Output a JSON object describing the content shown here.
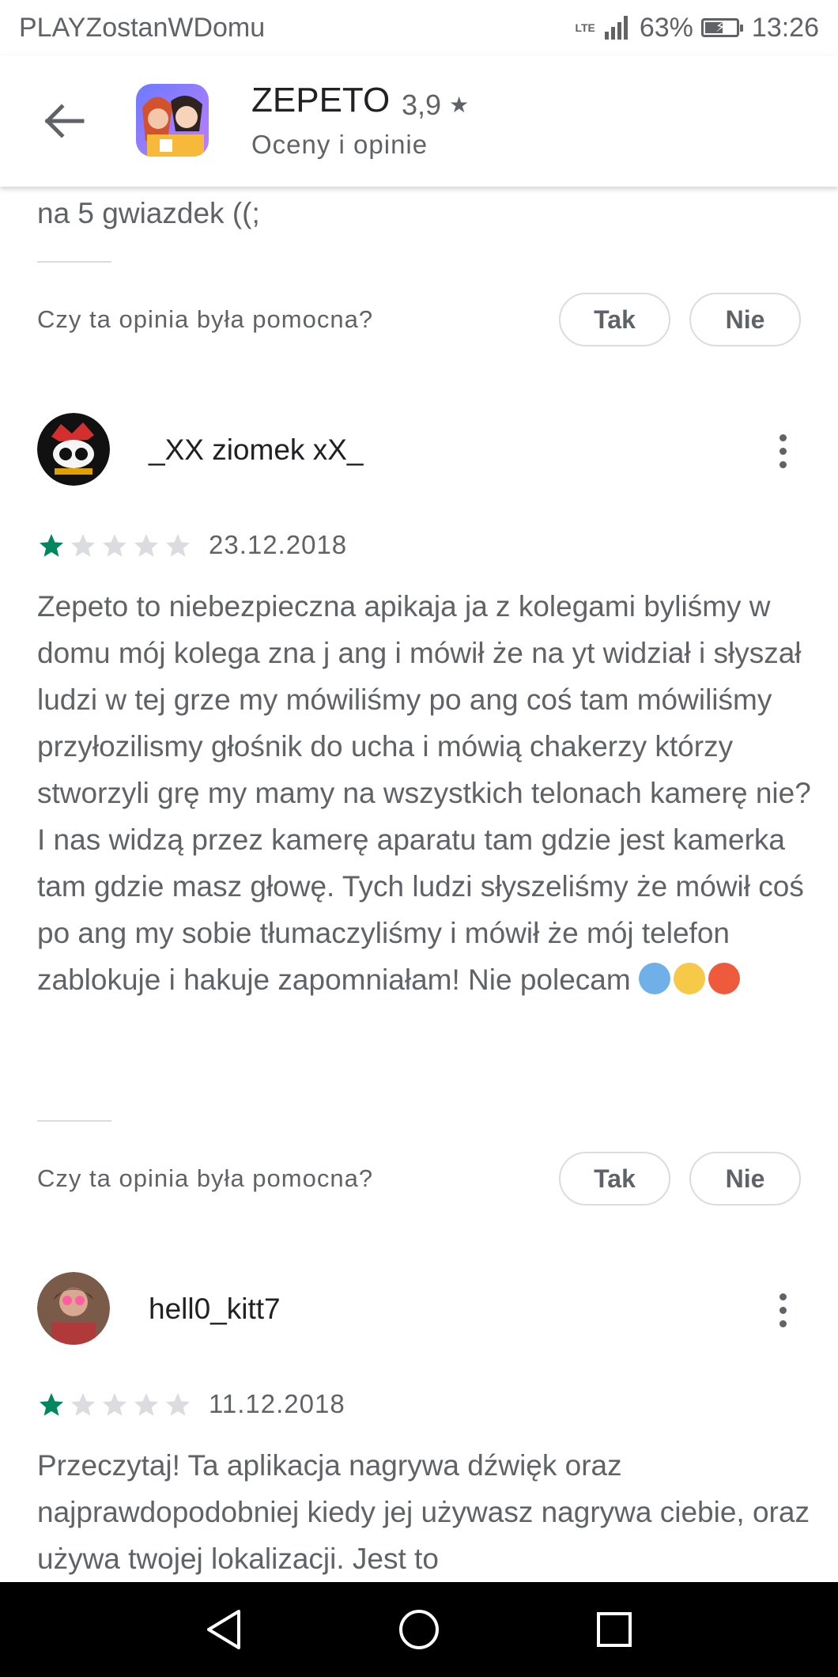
{
  "status_bar": {
    "carrier": "PLAYZostanWDomu",
    "network": "LTE",
    "battery": "63%",
    "battery_level": 0.63,
    "time": "13:26"
  },
  "header": {
    "app_name": "ZEPETO",
    "rating": "3,9",
    "subtitle": "Oceny i opinie",
    "back_icon": "arrow-back-icon"
  },
  "partial_review": {
    "text_tail": "na 5 gwiazdek ((;",
    "helpful_question": "Czy ta opinia była pomocna?",
    "yes_label": "Tak",
    "no_label": "Nie"
  },
  "reviews": [
    {
      "author": "_XX ziomek xX_",
      "stars": 1,
      "max_stars": 5,
      "date": "23.12.2018",
      "text": "Zepeto to niebezpieczna apikaja ja z kolegami byliśmy w domu mój kolega zna j ang i mówił że na yt widział i słyszał ludzi w tej grze my mówiliśmy po ang coś tam mówiliśmy przyłozilismy głośnik do ucha i mówią chakerzy którzy stworzyli grę my mamy na wszystkich telonach kamerę nie? I nas widzą przez kamerę aparatu tam gdzie jest kamerka tam gdzie masz głowę. Tych ludzi słyszeliśmy że mówił coś po ang my sobie tłumaczyliśmy i mówił że mój telefon zablokuje i hakuje zapomniałam! Nie polecam",
      "emojis": [
        "anxious-face-emoji",
        "grimacing-face-emoji",
        "angry-face-emoji"
      ],
      "helpful_question": "Czy ta opinia była pomocna?",
      "yes_label": "Tak",
      "no_label": "Nie"
    },
    {
      "author": "hell0_kitt7",
      "stars": 1,
      "max_stars": 5,
      "date": "11.12.2018",
      "text": "Przeczytaj! Ta aplikacja nagrywa dźwięk oraz najprawdopodobniej kiedy jej używasz nagrywa ciebie, oraz używa twojej lokalizacji. Jest to"
    }
  ],
  "nav_bar": {
    "back_icon": "nav-back-icon",
    "home_icon": "nav-home-icon",
    "recents_icon": "nav-recents-icon"
  },
  "colors": {
    "star_filled": "#01875f",
    "star_empty": "#dadce0",
    "text_secondary": "#5f6368"
  }
}
